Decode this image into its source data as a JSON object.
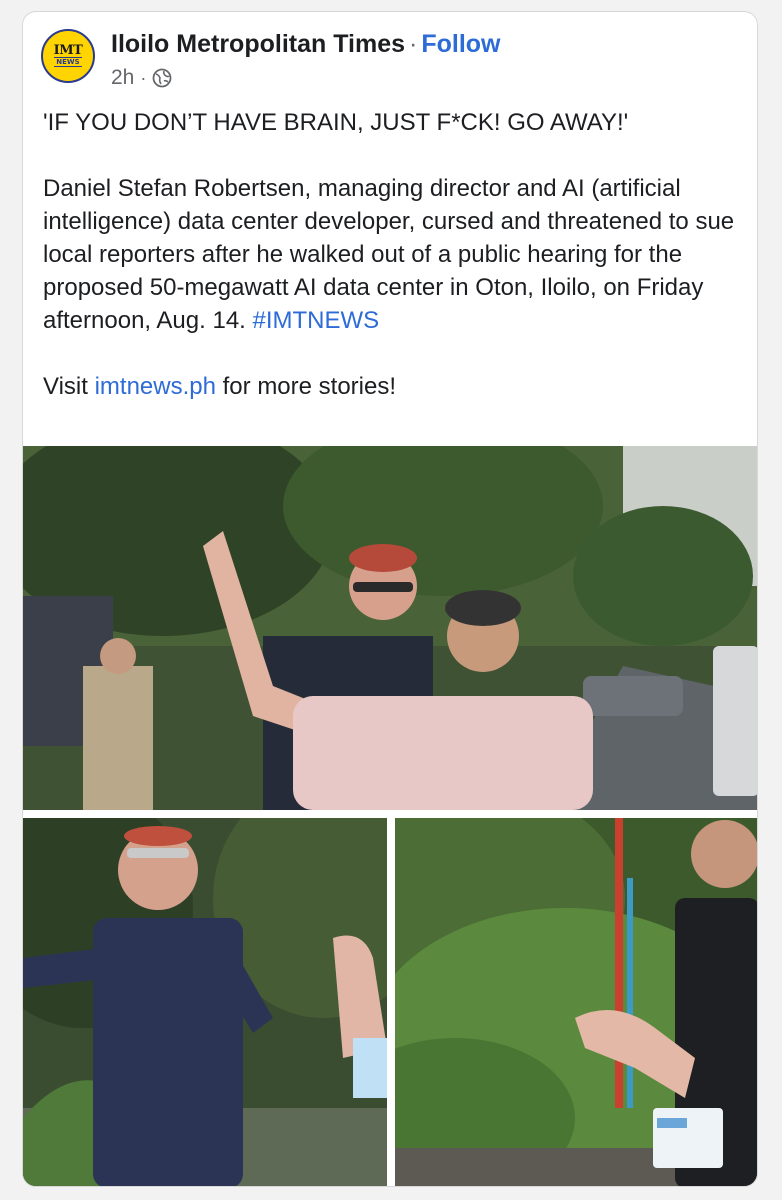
{
  "post": {
    "page_name": "Iloilo Metropolitan Times",
    "separator": "·",
    "follow_label": "Follow",
    "time": "2h",
    "time_separator": "·",
    "privacy_icon": "globe-icon",
    "avatar_logo_top": "IMT",
    "avatar_logo_bottom": "NEWS",
    "headline": "'IF YOU DON’T HAVE BRAIN, JUST F*CK! GO AWAY!'",
    "body": "Daniel Stefan Robertsen, managing director and AI (artificial intelligence) data center developer, cursed and threatened to sue local reporters after he walked out of a public hearing for the proposed 50-megawatt AI data center in Oton, Iloilo, on Friday afternoon, Aug. 14.",
    "hashtag": "#IMTNEWS",
    "visit_prefix": "Visit",
    "visit_link": "imtnews.ph",
    "visit_suffix": "for more stories!"
  },
  "colors": {
    "link": "#2d6bd6",
    "text": "#1c1e21",
    "meta": "#65676b",
    "avatar_bg": "#ffd400"
  }
}
